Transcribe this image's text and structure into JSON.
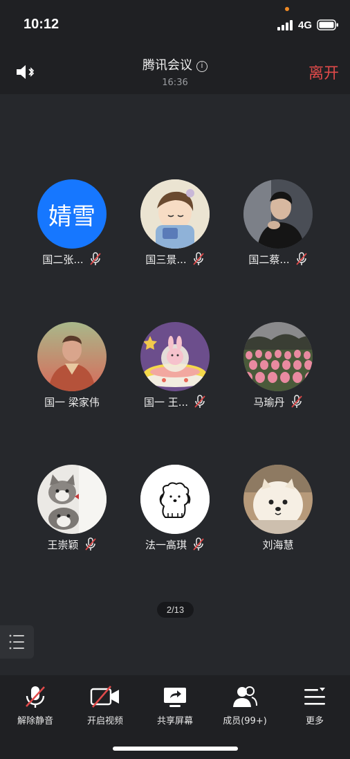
{
  "status": {
    "time": "10:12",
    "network": "4G"
  },
  "header": {
    "title": "腾讯会议",
    "meeting_time": "16:36",
    "leave_label": "离开"
  },
  "participants": [
    {
      "name": "国二张...",
      "muted": true,
      "avatar": "text-avatar",
      "avatar_text": "婧雪"
    },
    {
      "name": "国三景...",
      "muted": true,
      "avatar": "cartoon-boy"
    },
    {
      "name": "国二蔡...",
      "muted": true,
      "avatar": "photo-man"
    },
    {
      "name": "国一 梁家伟",
      "muted": false,
      "avatar": "photo-man-red"
    },
    {
      "name": "国一 王...",
      "muted": true,
      "avatar": "rabbit-ufo"
    },
    {
      "name": "马瑜丹",
      "muted": true,
      "avatar": "tulips"
    },
    {
      "name": "王崇颖",
      "muted": true,
      "avatar": "cats"
    },
    {
      "name": "法一高琪",
      "muted": true,
      "avatar": "dog-drawing"
    },
    {
      "name": "刘海慧",
      "muted": false,
      "avatar": "pomeranian"
    }
  ],
  "pagination": {
    "label": "2/13"
  },
  "toolbar": {
    "unmute_label": "解除静音",
    "video_label": "开启视频",
    "share_label": "共享屏幕",
    "members_label": "成员(99+)",
    "more_label": "更多"
  },
  "colors": {
    "leave": "#e04a4a",
    "mute_slash": "#e04a4a",
    "text_avatar_bg": "#1677ff"
  }
}
